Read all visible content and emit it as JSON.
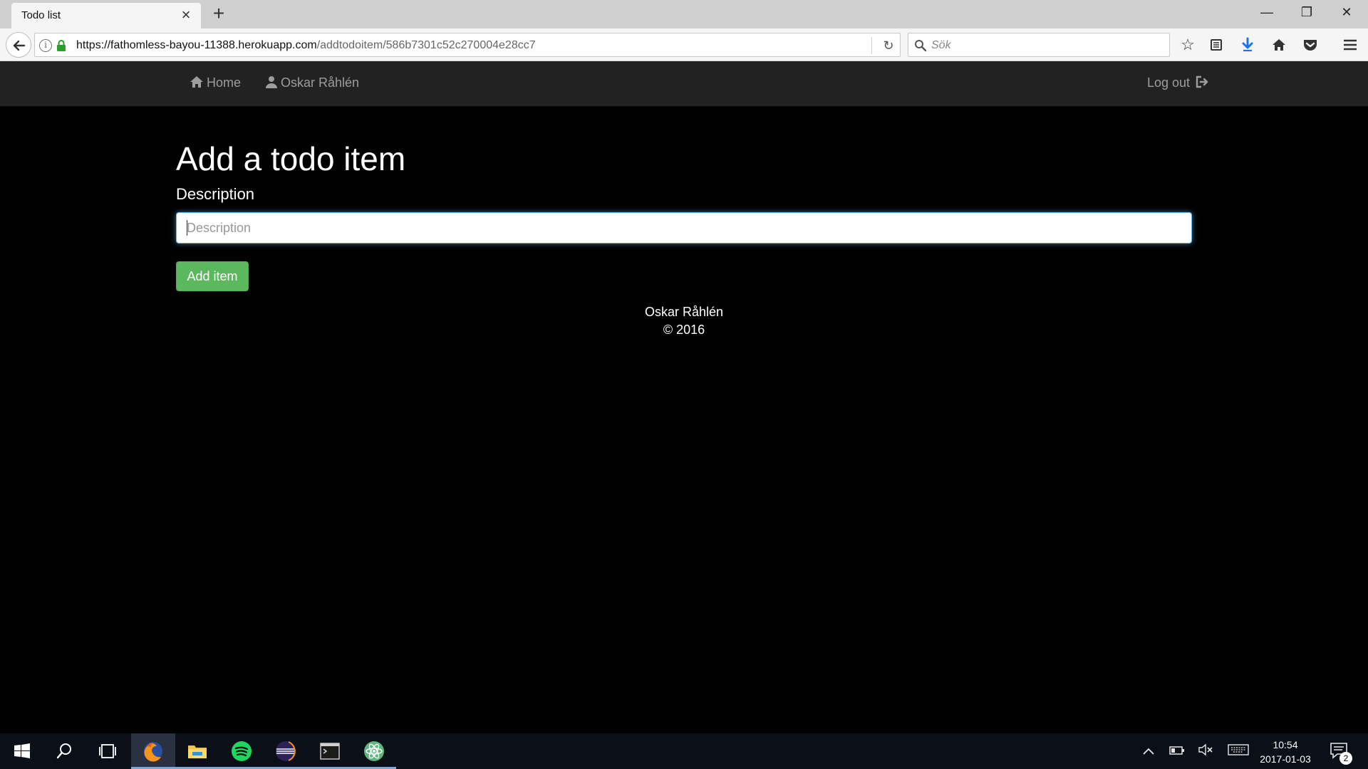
{
  "browser": {
    "tab_title": "Todo list",
    "url_host": "https://fathomless-bayou-11388.herokuapp.com",
    "url_path": "/addtodoitem/586b7301c52c270004e28cc7",
    "search_placeholder": "Sök",
    "icons": [
      "back-icon",
      "info-icon",
      "lock-icon",
      "reload-icon",
      "search-icon",
      "star-icon",
      "reading-list-icon",
      "download-icon",
      "home-icon",
      "pocket-icon",
      "menu-icon"
    ]
  },
  "app_nav": {
    "home_label": "Home",
    "user_label": "Oskar Råhlén",
    "logout_label": "Log out"
  },
  "form": {
    "title": "Add a todo item",
    "description_label": "Description",
    "description_placeholder": "Description",
    "description_value": "",
    "submit_label": "Add item"
  },
  "footer": {
    "author": "Oskar Råhlén",
    "copyright": "© 2016"
  },
  "taskbar": {
    "time": "10:54",
    "date": "2017-01-03",
    "notification_count": "2",
    "apps": [
      "firefox-icon",
      "file-explorer-icon",
      "spotify-icon",
      "eclipse-icon",
      "terminal-icon",
      "atom-icon"
    ]
  },
  "colors": {
    "nav_bg": "#222222",
    "page_bg": "#000000",
    "success_button": "#5cb85c",
    "focus_ring": "#66afe9"
  }
}
